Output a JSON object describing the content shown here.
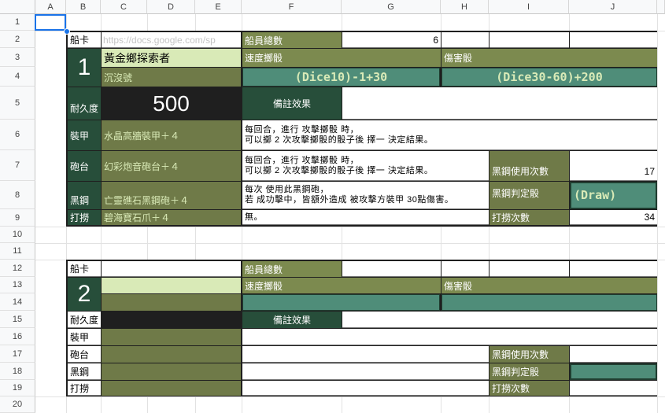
{
  "columns": [
    "A",
    "B",
    "C",
    "D",
    "E",
    "F",
    "G",
    "H",
    "I",
    "J"
  ],
  "rows": [
    "1",
    "2",
    "3",
    "4",
    "5",
    "6",
    "7",
    "8",
    "9",
    "10",
    "11",
    "12",
    "13",
    "14",
    "15",
    "16",
    "17",
    "18",
    "19",
    "20"
  ],
  "url_overlay": "https://docs.google.com/sp",
  "card1": {
    "card_label": "船卡",
    "crew_label": "船員總數",
    "crew_value": "6",
    "ship_number": "1",
    "ship_name": "黃金鄉探索者",
    "ship_subname": "沉沒號",
    "speed_label": "速度擲骰",
    "damage_label": "傷害骰",
    "speed_formula": "(Dice10)-1+30",
    "damage_formula": "(Dice30-60)+200",
    "durability_label": "耐久度",
    "durability_value": "500",
    "notes_label": "備註效果",
    "armor_label": "裝甲",
    "armor_item": "水晶高牆裝甲＋４",
    "armor_note_1": "每回合，進行 攻擊擲骰 時，",
    "armor_note_2": "可以擲 2 次攻擊擲骰的骰子後 擇一 決定結果。",
    "turret_label": "砲台",
    "turret_item": "幻彩炮音砲台＋４",
    "turret_note_1": "每回合，進行 攻擊擲骰 時，",
    "turret_note_2": "可以擲 2 次攻擊擲骰的骰子後 擇一 決定結果。",
    "black_steel_uses_label": "黑鋼使用次數",
    "black_steel_uses_value": "17",
    "black_steel_label": "黑鋼",
    "black_steel_item": "亡靈礁石黑鋼砲＋４",
    "black_steel_note_1": "每次 使用此黑鋼砲，",
    "black_steel_note_2": "若 成功擊中，皆額外造成 被攻擊方裝甲 30點傷害。",
    "black_steel_check_label": "黑鋼判定骰",
    "black_steel_check_value": "(Draw)",
    "salvage_label": "打撈",
    "salvage_item": "碧海寶石爪＋４",
    "salvage_note": "無。",
    "salvage_count_label": "打撈次數",
    "salvage_count_value": "34"
  },
  "card2": {
    "card_label": "船卡",
    "crew_label": "船員總數",
    "ship_number": "2",
    "speed_label": "速度擲骰",
    "damage_label": "傷害骰",
    "durability_label": "耐久度",
    "notes_label": "備註效果",
    "armor_label": "裝甲",
    "turret_label": "砲台",
    "black_steel_uses_label": "黑鋼使用次數",
    "black_steel_label": "黑鋼",
    "black_steel_check_label": "黑鋼判定骰",
    "salvage_label": "打撈",
    "salvage_count_label": "打撈次數"
  }
}
